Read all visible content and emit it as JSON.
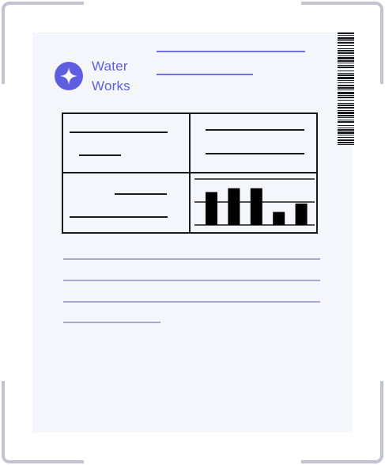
{
  "brand": {
    "line1": "Water",
    "line2": "Works",
    "logo_icon": "sparkle-star-icon",
    "accent_color": "#5f5ee0"
  },
  "barcode": {
    "icon": "barcode-icon"
  },
  "mini_chart": {
    "type": "bar",
    "values": [
      43,
      48,
      48,
      17,
      28
    ],
    "ylim": [
      0,
      60
    ],
    "bar_color": "#000000",
    "grid": true
  }
}
